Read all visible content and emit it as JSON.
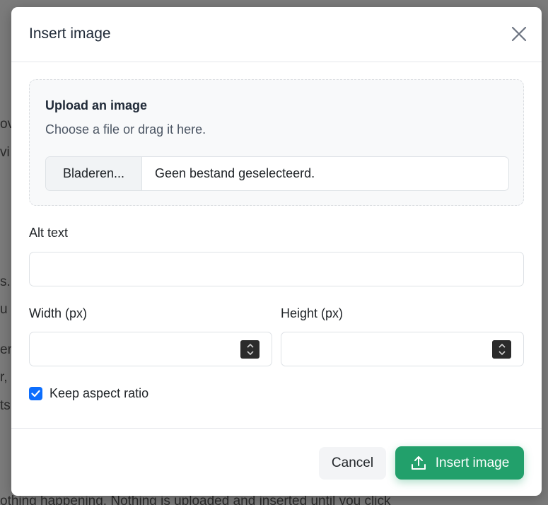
{
  "background": {
    "fragments": [
      "ov",
      "vi",
      "s.",
      "u",
      "er",
      "r, a",
      "ts",
      "othing happening. Nothing is uploaded and inserted until you click"
    ]
  },
  "modal": {
    "title": "Insert image",
    "close_icon": "close-icon"
  },
  "upload": {
    "title": "Upload an image",
    "hint": "Choose a file or drag it here.",
    "browse_label": "Bladeren...",
    "file_status": "Geen bestand geselecteerd."
  },
  "alt": {
    "label": "Alt text",
    "value": "",
    "placeholder": ""
  },
  "width": {
    "label": "Width (px)",
    "value": ""
  },
  "height": {
    "label": "Height (px)",
    "value": ""
  },
  "aspect": {
    "label": "Keep aspect ratio",
    "checked": true
  },
  "footer": {
    "cancel_label": "Cancel",
    "insert_label": "Insert image",
    "insert_icon": "upload-icon"
  },
  "colors": {
    "accent": "#22a06b",
    "checkbox": "#0d6efd",
    "overlay": "#7b7b7b"
  }
}
